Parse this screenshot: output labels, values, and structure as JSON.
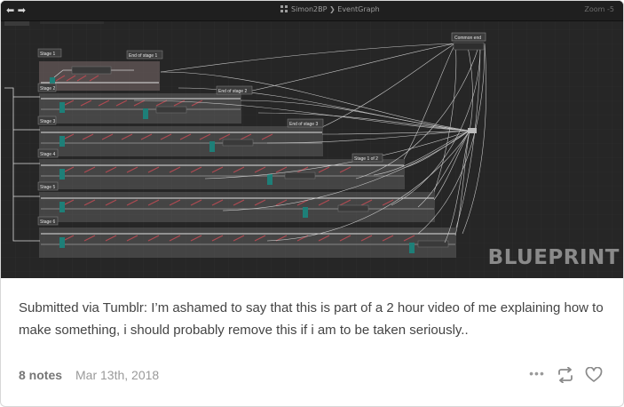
{
  "screenshot": {
    "breadcrumb_asset": "Simon2BP",
    "breadcrumb_separator": "❯",
    "breadcrumb_graph": "EventGraph",
    "zoom_text": "Zoom -5",
    "nav_arrows": "⬅ ➡",
    "watermark": "BLUEPRINT",
    "node_labels": {
      "stage1": "Stage 1",
      "stage2": "Stage 2",
      "stage3": "Stage 3",
      "stage4": "Stage 4",
      "stage5": "Stage 5",
      "stage6": "Stage 6",
      "end1": "End of stage 1",
      "end2": "End of stage 2",
      "end3": "End of stage 3",
      "end4": "Stage 1 of 2",
      "common_end": "Common end"
    }
  },
  "post": {
    "caption": "Submitted via Tumblr: I’m ashamed to say that this is part of a 2 hour video of me explaining how to make something, i should probably remove this if i am to be taken seriously..",
    "notes": "8 notes",
    "date": "Mar 13th, 2018",
    "more_icon": "more-dots-icon",
    "reblog_icon": "reblog-icon",
    "like_icon": "heart-icon"
  }
}
